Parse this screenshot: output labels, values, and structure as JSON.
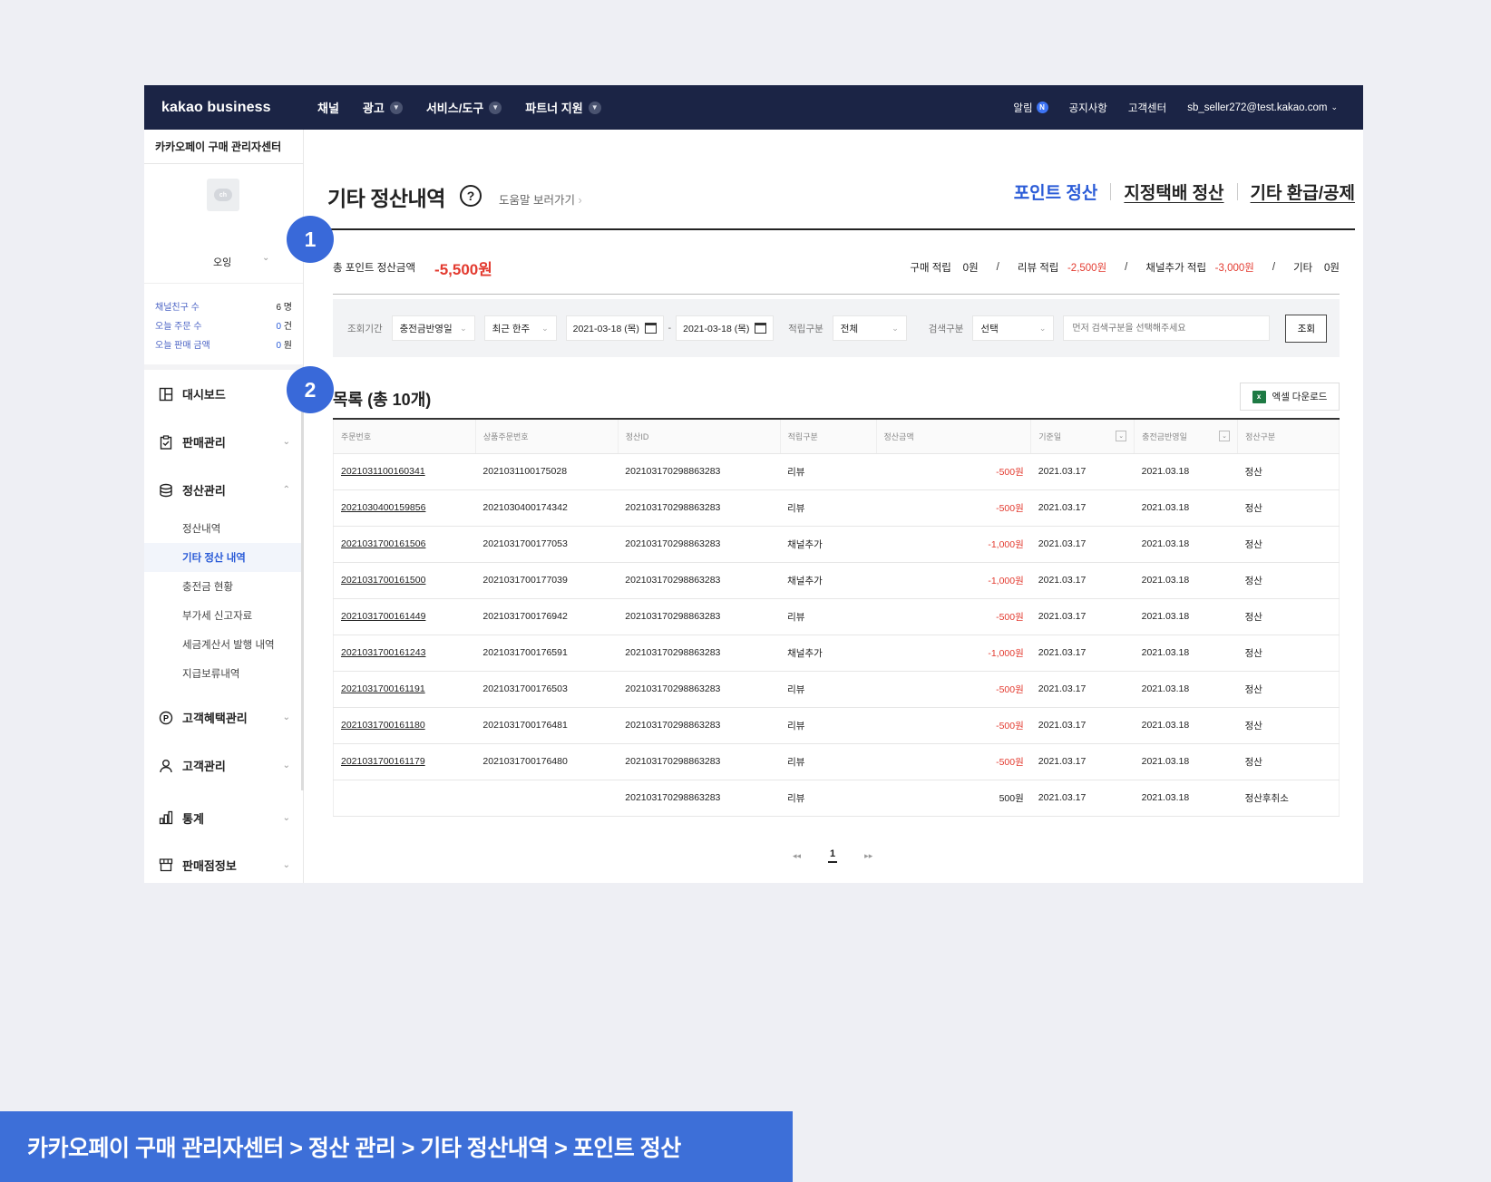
{
  "topbar": {
    "logo": "kakao business",
    "nav": [
      {
        "label": "채널",
        "has_dropdown": false
      },
      {
        "label": "광고",
        "has_dropdown": true
      },
      {
        "label": "서비스/도구",
        "has_dropdown": true
      },
      {
        "label": "파트너 지원",
        "has_dropdown": true
      }
    ],
    "util": {
      "alarm": "알림",
      "alarm_badge": "N",
      "notice": "공지사항",
      "support": "고객센터",
      "account": "sb_seller272@test.kakao.com"
    }
  },
  "sidebar": {
    "title": "카카오페이 구매 관리자센터",
    "channel_icon_text": "ch",
    "channel_name": "오잉",
    "stats": [
      {
        "label": "채널친구 수",
        "value": "6",
        "unit": "명"
      },
      {
        "label": "오늘 주문 수",
        "value": "0",
        "unit": "건"
      },
      {
        "label": "오늘 판매 금액",
        "value": "0",
        "unit": "원"
      }
    ],
    "menu": {
      "dashboard": "대시보드",
      "sales": "판매관리",
      "settlement": "정산관리",
      "settlement_sub": [
        "정산내역",
        "기타 정산 내역",
        "충전금 현황",
        "부가세 신고자료",
        "세금계산서 발행 내역",
        "지급보류내역"
      ],
      "benefit": "고객혜택관리",
      "customer": "고객관리",
      "stats": "통계",
      "shop": "판매점정보"
    }
  },
  "page": {
    "title": "기타 정산내역",
    "help_icon": "?",
    "help_link": "도움말 보러가기",
    "tabs": [
      "포인트 정산",
      "지정택배 정산",
      "기타 환급/공제"
    ]
  },
  "summary": {
    "label": "총 포인트 정산금액",
    "total": "-5,500원",
    "items": [
      {
        "label": "구매 적립",
        "value": "0원",
        "negative": false
      },
      {
        "label": "리뷰 적립",
        "value": "-2,500원",
        "negative": true
      },
      {
        "label": "채널추가 적립",
        "value": "-3,000원",
        "negative": true
      },
      {
        "label": "기타",
        "value": "0원",
        "negative": false
      }
    ]
  },
  "filter": {
    "period_label": "조회기간",
    "period_type": "충전금반영일",
    "period_range": "최근 한주",
    "date_from": "2021-03-18 (목)",
    "date_to": "2021-03-18 (목)",
    "type_label": "적립구분",
    "type_value": "전체",
    "search_label": "검색구분",
    "search_value": "선택",
    "search_placeholder": "먼저 검색구분을 선택해주세요",
    "search_button": "조회"
  },
  "list": {
    "title": "목록 (총 10개)",
    "excel_button": "엑셀 다운로드",
    "columns": [
      "주문번호",
      "상품주문번호",
      "정산ID",
      "적립구분",
      "정산금액",
      "기준일",
      "충전금반영일",
      "정산구분"
    ],
    "rows": [
      [
        "2021031100160341",
        "2021031100175028",
        "202103170298863283",
        "리뷰",
        "-500원",
        "2021.03.17",
        "2021.03.18",
        "정산"
      ],
      [
        "2021030400159856",
        "2021030400174342",
        "202103170298863283",
        "리뷰",
        "-500원",
        "2021.03.17",
        "2021.03.18",
        "정산"
      ],
      [
        "2021031700161506",
        "2021031700177053",
        "202103170298863283",
        "채널추가",
        "-1,000원",
        "2021.03.17",
        "2021.03.18",
        "정산"
      ],
      [
        "2021031700161500",
        "2021031700177039",
        "202103170298863283",
        "채널추가",
        "-1,000원",
        "2021.03.17",
        "2021.03.18",
        "정산"
      ],
      [
        "2021031700161449",
        "2021031700176942",
        "202103170298863283",
        "리뷰",
        "-500원",
        "2021.03.17",
        "2021.03.18",
        "정산"
      ],
      [
        "2021031700161243",
        "2021031700176591",
        "202103170298863283",
        "채널추가",
        "-1,000원",
        "2021.03.17",
        "2021.03.18",
        "정산"
      ],
      [
        "2021031700161191",
        "2021031700176503",
        "202103170298863283",
        "리뷰",
        "-500원",
        "2021.03.17",
        "2021.03.18",
        "정산"
      ],
      [
        "2021031700161180",
        "2021031700176481",
        "202103170298863283",
        "리뷰",
        "-500원",
        "2021.03.17",
        "2021.03.18",
        "정산"
      ],
      [
        "2021031700161179",
        "2021031700176480",
        "202103170298863283",
        "리뷰",
        "-500원",
        "2021.03.17",
        "2021.03.18",
        "정산"
      ],
      [
        "",
        "",
        "202103170298863283",
        "리뷰",
        "500원",
        "2021.03.17",
        "2021.03.18",
        "정산후취소"
      ]
    ]
  },
  "pagination": {
    "current": "1"
  },
  "markers": [
    "1",
    "2"
  ],
  "breadcrumb": "카카오페이 구매 관리자센터 > 정산 관리 > 기타 정산내역 > 포인트 정산",
  "colors": {
    "topbar": "#1b2445",
    "accent": "#2a5bd7",
    "negative": "#e33b30",
    "marker": "#3969d9"
  }
}
